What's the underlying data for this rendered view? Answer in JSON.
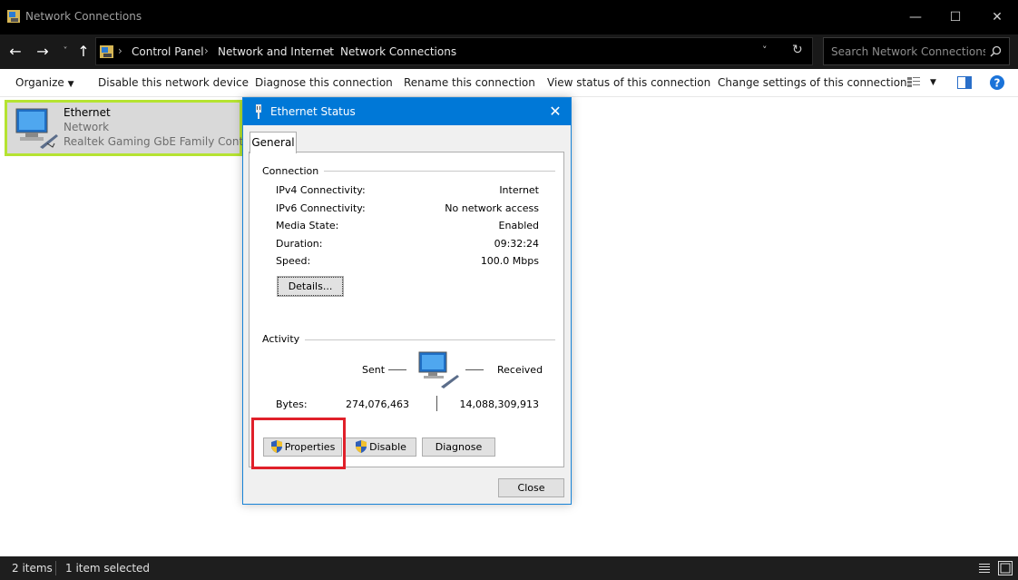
{
  "window": {
    "title": "Network Connections"
  },
  "address": {
    "crumbs": [
      "Control Panel",
      "Network and Internet",
      "Network Connections"
    ],
    "search_placeholder": "Search Network Connections"
  },
  "commands": {
    "organize": "Organize",
    "disable": "Disable this network device",
    "diagnose": "Diagnose this connection",
    "rename": "Rename this connection",
    "view_status": "View status of this connection",
    "change_settings": "Change settings of this connection"
  },
  "item": {
    "name": "Ethernet",
    "network": "Network",
    "adapter": "Realtek Gaming GbE Family Contr..."
  },
  "status": {
    "count": "2 items",
    "selected": "1 item selected"
  },
  "dialog": {
    "title": "Ethernet Status",
    "tab": "General",
    "connection_group": "Connection",
    "rows": [
      {
        "label": "IPv4 Connectivity:",
        "value": "Internet"
      },
      {
        "label": "IPv6 Connectivity:",
        "value": "No network access"
      },
      {
        "label": "Media State:",
        "value": "Enabled"
      },
      {
        "label": "Duration:",
        "value": "09:32:24"
      },
      {
        "label": "Speed:",
        "value": "100.0 Mbps"
      }
    ],
    "details_button": "Details...",
    "activity_group": "Activity",
    "sent_label": "Sent",
    "received_label": "Received",
    "bytes_label": "Bytes:",
    "bytes_sent": "274,076,463",
    "bytes_received": "14,088,309,913",
    "properties_button": "Properties",
    "disable_button": "Disable",
    "diagnose_button": "Diagnose",
    "close_button": "Close"
  },
  "colors": {
    "accent": "#0078d7",
    "selection_outline": "#b5e331",
    "highlight_box": "#e0202a"
  }
}
